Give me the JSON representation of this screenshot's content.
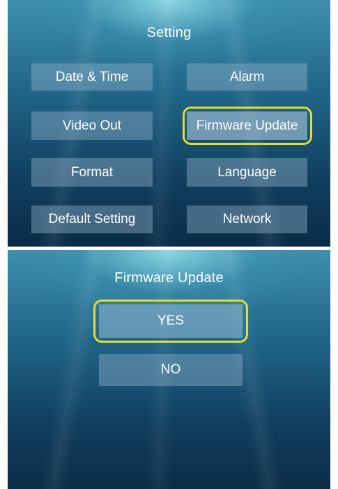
{
  "settings_menu": {
    "title": "Setting",
    "items": [
      {
        "label": "Date & Time"
      },
      {
        "label": "Alarm"
      },
      {
        "label": "Video Out"
      },
      {
        "label": "Firmware Update"
      },
      {
        "label": "Format"
      },
      {
        "label": "Language"
      },
      {
        "label": "Default Setting"
      },
      {
        "label": "Network"
      }
    ],
    "selected_item": "Firmware Update"
  },
  "firmware_dialog": {
    "title": "Firmware Update",
    "yes_label": "YES",
    "no_label": "NO",
    "selected_option": "YES"
  },
  "colors": {
    "selection_highlight": "#e7dd2a",
    "button_text": "#ffffff",
    "background_deep": "#0a2c47",
    "background_light": "#3e8fae"
  }
}
